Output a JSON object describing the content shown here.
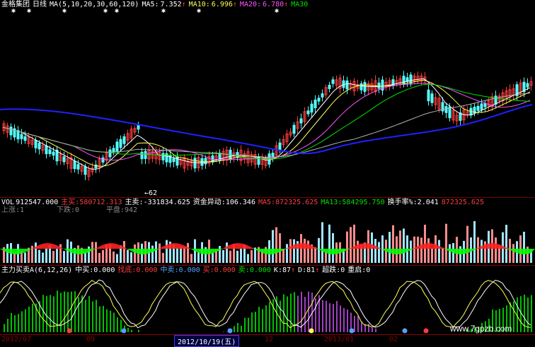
{
  "colors": {
    "bg": "#000000",
    "up": "#ff3c3c",
    "down": "#54ffff",
    "white": "#ffffff",
    "yellow": "#ffff54",
    "magenta": "#ff54ff",
    "green": "#00e000",
    "blue": "#2020ff",
    "grid": "#8b0000"
  },
  "header": {
    "title": "金格集团",
    "period": "日线",
    "ma_params": "MA(5,10,20,30,60,120)",
    "ma5_label": "MA5:",
    "ma5_value": "7.352",
    "ma10_label": "MA10:",
    "ma10_value": "6.996",
    "ma20_label": "MA20:",
    "ma20_value": "6.780",
    "ma30_label": "MA30",
    "arrow": "↑"
  },
  "price_panel": {
    "low_label": "62"
  },
  "vol_panel": {
    "vol_label": "VOL",
    "vol_value": "912547.000",
    "main_buy_label": "主买:",
    "main_buy_value": "580712.313",
    "main_sell_label": "主卖:",
    "main_sell_value": "-331834.625",
    "fund_label": "资金异动:",
    "fund_value": "106.346",
    "ma5_label": "MA5:",
    "ma5_value": "872325.625",
    "ma13_label": "MA13:",
    "ma13_value": "584295.750",
    "turnover_label": "换手率%:",
    "turnover_value": "2.041",
    "tail_value": "872325.625",
    "up_label": "上涨:1",
    "down_label": "下跌:0",
    "flat_label": "平盘:942"
  },
  "indicator_panel": {
    "name": "主力买卖A(6,12,26)",
    "zhongmai_label": "中买:",
    "zhongmai_value": "0.000",
    "zhaodi_label": "找底:",
    "zhaodi_value": "0.000",
    "zhongmai2_label": "中卖:",
    "zhongmai2_value": "0.000",
    "buy_label": "买:",
    "buy_value": "0.000",
    "sell_label": "卖:",
    "sell_value": "0.000",
    "k_label": "K:",
    "k_value": "87",
    "d_label": "D:",
    "d_value": "81",
    "chaodie_label": "超跌:",
    "chaodie_value": "0",
    "chongqi_label": "重启:",
    "chongqi_value": "0"
  },
  "date_axis": {
    "labels": [
      "2012/07",
      "09",
      "2012/10/19(五)",
      "12",
      "2013/01",
      "02"
    ]
  },
  "watermark": "www.7gpzb.com"
}
